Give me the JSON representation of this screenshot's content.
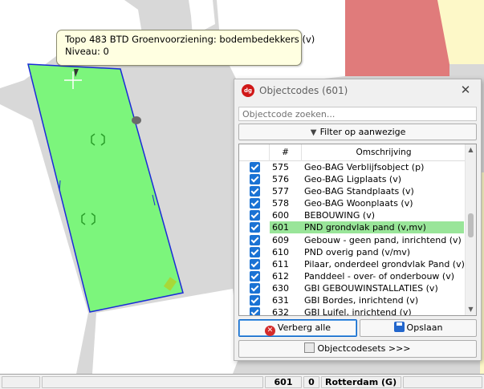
{
  "tooltip": {
    "line1": "Topo 483  BTD Groenvoorziening: bodembedekkers (v)",
    "line2": "Niveau: 0"
  },
  "dialog": {
    "title": "Objectcodes (601)",
    "search_placeholder": "Objectcode zoeken...",
    "filter_label": "Filter op aanwezige",
    "col_num": "#",
    "col_desc": "Omschrijving",
    "rows": [
      {
        "code": "575",
        "desc": "Geo-BAG Verblijfsobject (p)",
        "checked": true
      },
      {
        "code": "576",
        "desc": "Geo-BAG Ligplaats (v)",
        "checked": true
      },
      {
        "code": "577",
        "desc": "Geo-BAG Standplaats (v)",
        "checked": true
      },
      {
        "code": "578",
        "desc": "Geo-BAG Woonplaats (v)",
        "checked": true
      },
      {
        "code": "600",
        "desc": "BEBOUWING (v)",
        "checked": true
      },
      {
        "code": "601",
        "desc": "PND grondvlak pand (v,mv)",
        "checked": true,
        "selected": true
      },
      {
        "code": "609",
        "desc": "Gebouw - geen pand, inrichtend (v)",
        "checked": true
      },
      {
        "code": "610",
        "desc": "PND overig pand (v/mv)",
        "checked": true
      },
      {
        "code": "611",
        "desc": "Pilaar, onderdeel grondvlak Pand (v)",
        "checked": true
      },
      {
        "code": "612",
        "desc": "Panddeel - over- of onderbouw (v)",
        "checked": true
      },
      {
        "code": "630",
        "desc": "GBI GEBOUWINSTALLATIES (v)",
        "checked": true
      },
      {
        "code": "631",
        "desc": "GBI Bordes, inrichtend (v)",
        "checked": true
      },
      {
        "code": "632",
        "desc": "GBI Luifel, inrichtend (v)",
        "checked": true
      }
    ],
    "hide_all_label": "Verberg alle",
    "save_label": "Opslaan",
    "sets_label": "Objectcodesets >>>"
  },
  "status": {
    "code": "601",
    "level": "0",
    "place": "Rotterdam (G)"
  },
  "colors": {
    "polygon_fill": "#7cf57c",
    "polygon_edge": "#1a2bd8",
    "road": "#dcdcdc",
    "building_red": "#e07b7b",
    "highlight_row": "#99e599"
  }
}
